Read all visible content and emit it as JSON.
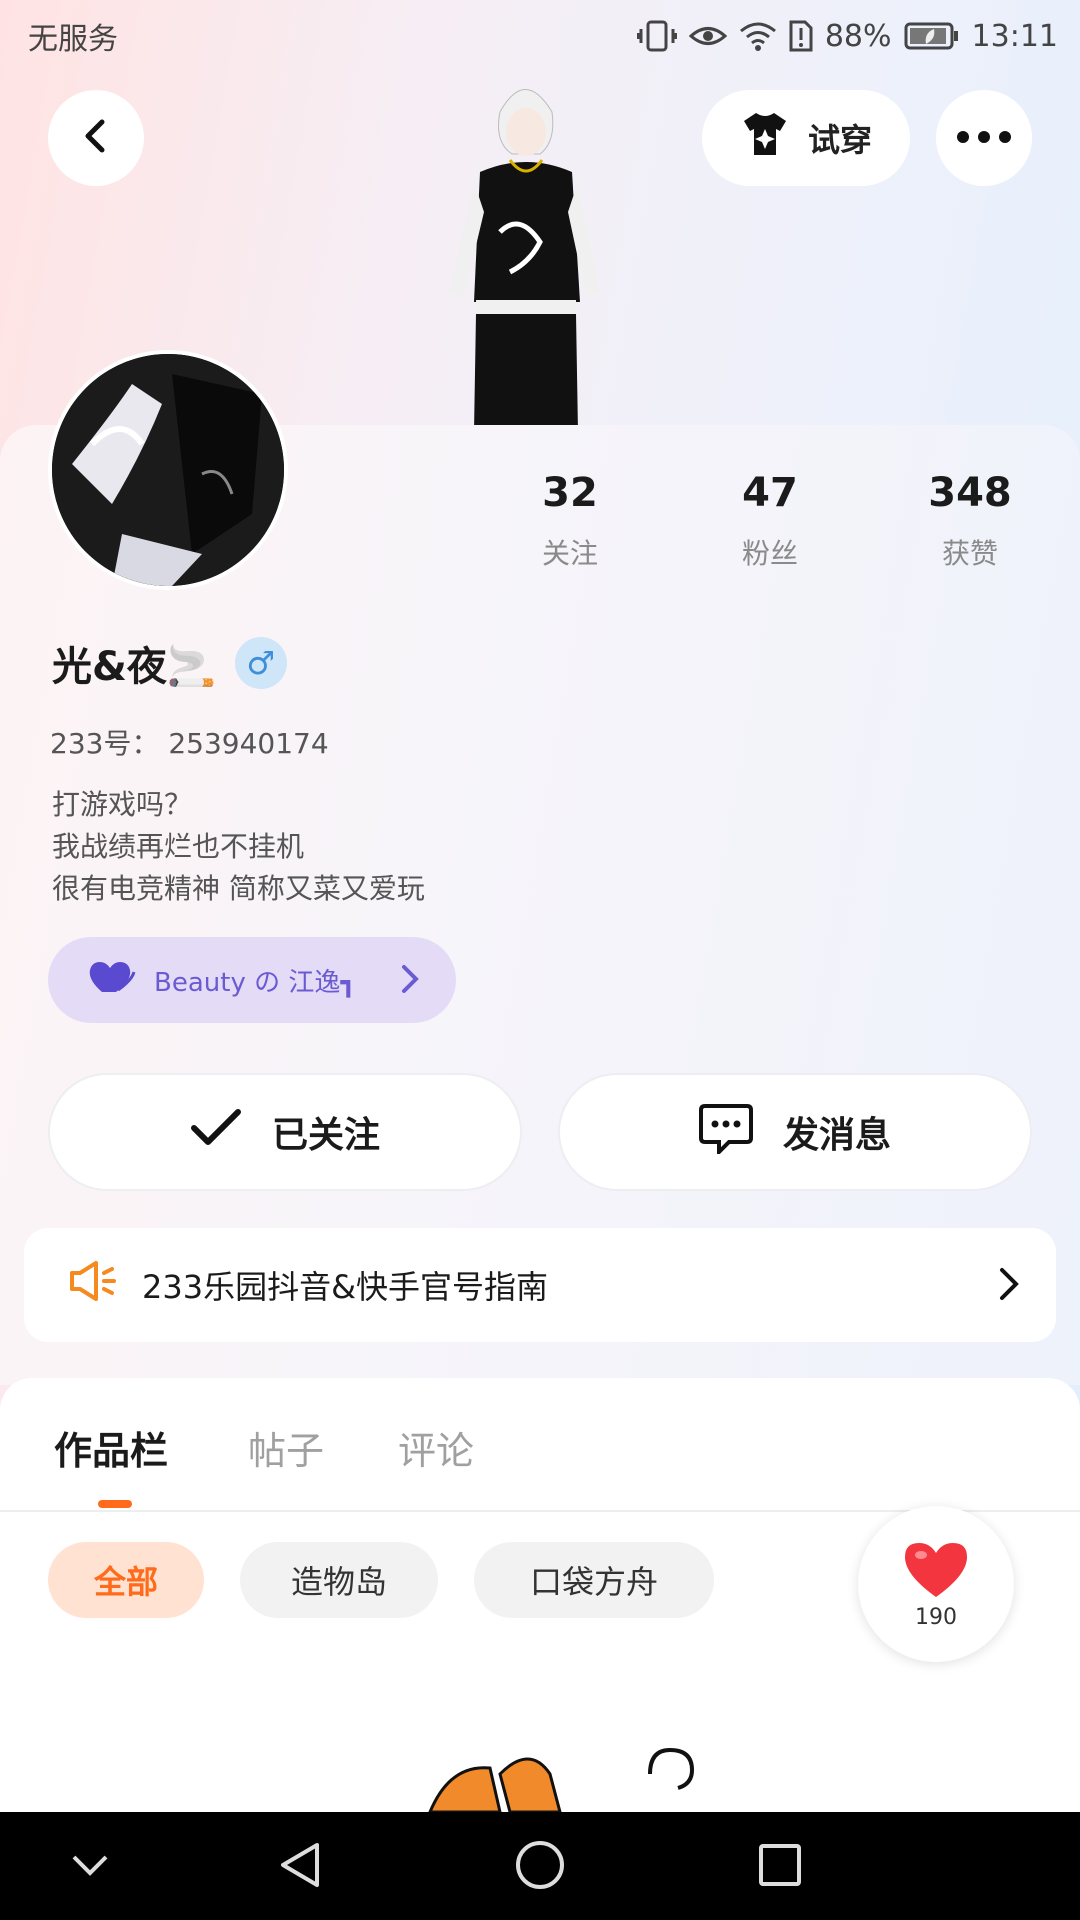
{
  "status_bar": {
    "carrier": "无服务",
    "battery": "88%",
    "time": "13:11"
  },
  "top_bar": {
    "tryon_label": "试穿"
  },
  "profile": {
    "stats": [
      {
        "value": "32",
        "label": "关注"
      },
      {
        "value": "47",
        "label": "粉丝"
      },
      {
        "value": "348",
        "label": "获赞"
      }
    ],
    "username": "光&夜🚬",
    "gender_symbol": "♂",
    "user_id": "233号：  253940174",
    "bio_lines": [
      "打游戏吗？",
      "我战绩再烂也不挂机",
      "很有电竞精神 简称又菜又爱玩"
    ],
    "group_name": "Beauty の 江逸┓"
  },
  "actions": {
    "follow_label": "已关注",
    "message_label": "发消息"
  },
  "notice": {
    "text": "233乐园抖音&快手官号指南"
  },
  "tabs": [
    "作品栏",
    "帖子",
    "评论"
  ],
  "filters": [
    "全部",
    "造物岛",
    "口袋方舟"
  ],
  "like_widget": {
    "count": "190"
  },
  "colors": {
    "accent": "#ff6b1a",
    "group_chip": "#e4dcf7",
    "gender": "#3f8fd8"
  }
}
